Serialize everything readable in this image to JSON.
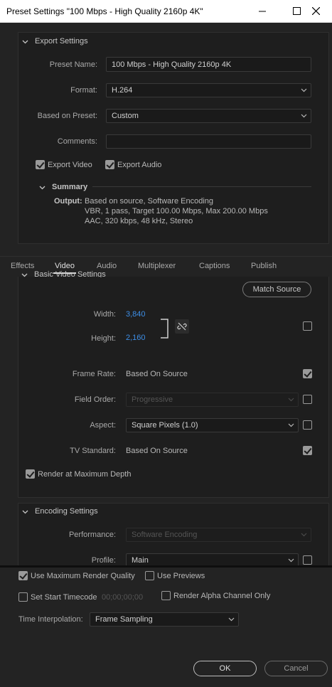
{
  "window": {
    "title": "Preset Settings \"100 Mbps - High Quality 2160p 4K\""
  },
  "export_settings": {
    "header": "Export Settings",
    "preset_name_label": "Preset Name:",
    "preset_name_value": "100 Mbps - High Quality 2160p 4K",
    "format_label": "Format:",
    "format_value": "H.264",
    "based_on_label": "Based on Preset:",
    "based_on_value": "Custom",
    "comments_label": "Comments:",
    "comments_value": "",
    "export_video_label": "Export Video",
    "export_video_checked": true,
    "export_audio_label": "Export Audio",
    "export_audio_checked": true
  },
  "summary": {
    "header": "Summary",
    "output_label": "Output:",
    "line1": "Based on source, Software Encoding",
    "line2": "VBR, 1 pass, Target 100.00 Mbps, Max 200.00 Mbps",
    "line3": "AAC, 320 kbps, 48 kHz, Stereo"
  },
  "tabs": [
    "Effects",
    "Video",
    "Audio",
    "Multiplexer",
    "Captions",
    "Publish"
  ],
  "active_tab": "Video",
  "video": {
    "section_header": "Basic Video Settings",
    "match_source": "Match Source",
    "width_label": "Width:",
    "width_value": "3,840",
    "height_label": "Height:",
    "height_value": "2,160",
    "frame_rate_label": "Frame Rate:",
    "frame_rate_value": "Based On Source",
    "field_order_label": "Field Order:",
    "field_order_value": "Progressive",
    "aspect_label": "Aspect:",
    "aspect_value": "Square Pixels (1.0)",
    "tv_standard_label": "TV Standard:",
    "tv_standard_value": "Based On Source",
    "render_max_depth_label": "Render at Maximum Depth"
  },
  "encoding": {
    "header": "Encoding Settings",
    "performance_label": "Performance:",
    "performance_value": "Software Encoding",
    "profile_label": "Profile:",
    "profile_value": "Main"
  },
  "bottom": {
    "use_max_render_label": "Use Maximum Render Quality",
    "use_previews_label": "Use Previews",
    "set_start_tc_label": "Set Start Timecode",
    "start_tc_value": "00;00;00;00",
    "render_alpha_label": "Render Alpha Channel Only",
    "time_interp_label": "Time Interpolation:",
    "time_interp_value": "Frame Sampling"
  },
  "buttons": {
    "ok": "OK",
    "cancel": "Cancel"
  },
  "colors": {
    "accent_link": "#3d8ee6",
    "background": "#232323",
    "panel": "#1e1e1e"
  }
}
